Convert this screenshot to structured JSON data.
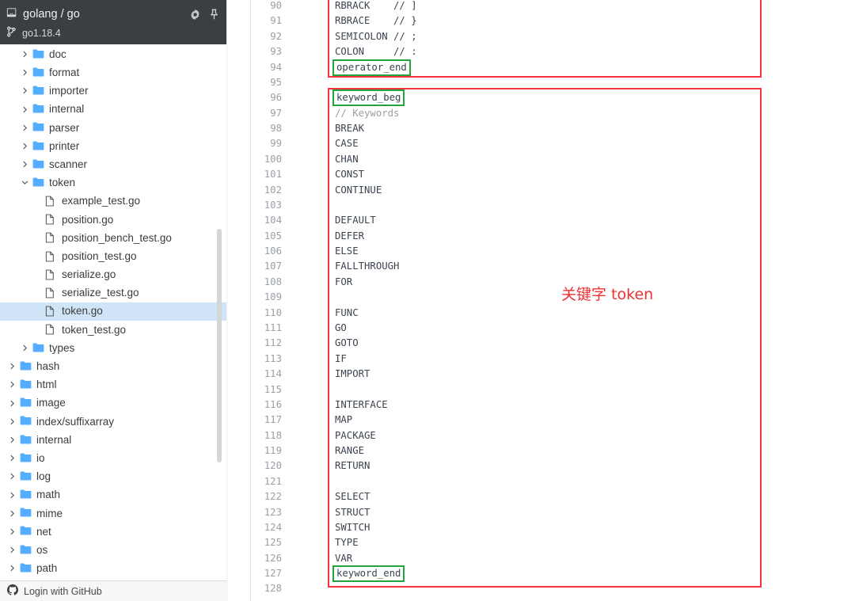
{
  "sidebar": {
    "header": {
      "repo_icon": "repository-icon",
      "repo_name": "golang / go",
      "branch_icon": "branch-icon",
      "branch_name": "go1.18.4",
      "settings_icon": "gear-icon",
      "pin_icon": "pin-icon"
    },
    "tree": [
      {
        "name": "doc",
        "type": "folder",
        "depth": 1,
        "expanded": false,
        "selected": false
      },
      {
        "name": "format",
        "type": "folder",
        "depth": 1,
        "expanded": false,
        "selected": false
      },
      {
        "name": "importer",
        "type": "folder",
        "depth": 1,
        "expanded": false,
        "selected": false
      },
      {
        "name": "internal",
        "type": "folder",
        "depth": 1,
        "expanded": false,
        "selected": false
      },
      {
        "name": "parser",
        "type": "folder",
        "depth": 1,
        "expanded": false,
        "selected": false
      },
      {
        "name": "printer",
        "type": "folder",
        "depth": 1,
        "expanded": false,
        "selected": false
      },
      {
        "name": "scanner",
        "type": "folder",
        "depth": 1,
        "expanded": false,
        "selected": false
      },
      {
        "name": "token",
        "type": "folder",
        "depth": 1,
        "expanded": true,
        "selected": false
      },
      {
        "name": "example_test.go",
        "type": "file",
        "depth": 2,
        "expanded": null,
        "selected": false
      },
      {
        "name": "position.go",
        "type": "file",
        "depth": 2,
        "expanded": null,
        "selected": false
      },
      {
        "name": "position_bench_test.go",
        "type": "file",
        "depth": 2,
        "expanded": null,
        "selected": false
      },
      {
        "name": "position_test.go",
        "type": "file",
        "depth": 2,
        "expanded": null,
        "selected": false
      },
      {
        "name": "serialize.go",
        "type": "file",
        "depth": 2,
        "expanded": null,
        "selected": false
      },
      {
        "name": "serialize_test.go",
        "type": "file",
        "depth": 2,
        "expanded": null,
        "selected": false
      },
      {
        "name": "token.go",
        "type": "file",
        "depth": 2,
        "expanded": null,
        "selected": true
      },
      {
        "name": "token_test.go",
        "type": "file",
        "depth": 2,
        "expanded": null,
        "selected": false
      },
      {
        "name": "types",
        "type": "folder",
        "depth": 1,
        "expanded": false,
        "selected": false
      },
      {
        "name": "hash",
        "type": "folder",
        "depth": 0,
        "expanded": false,
        "selected": false
      },
      {
        "name": "html",
        "type": "folder",
        "depth": 0,
        "expanded": false,
        "selected": false
      },
      {
        "name": "image",
        "type": "folder",
        "depth": 0,
        "expanded": false,
        "selected": false
      },
      {
        "name": "index/suffixarray",
        "type": "folder",
        "depth": 0,
        "expanded": false,
        "selected": false
      },
      {
        "name": "internal",
        "type": "folder",
        "depth": 0,
        "expanded": false,
        "selected": false
      },
      {
        "name": "io",
        "type": "folder",
        "depth": 0,
        "expanded": false,
        "selected": false
      },
      {
        "name": "log",
        "type": "folder",
        "depth": 0,
        "expanded": false,
        "selected": false
      },
      {
        "name": "math",
        "type": "folder",
        "depth": 0,
        "expanded": false,
        "selected": false
      },
      {
        "name": "mime",
        "type": "folder",
        "depth": 0,
        "expanded": false,
        "selected": false
      },
      {
        "name": "net",
        "type": "folder",
        "depth": 0,
        "expanded": false,
        "selected": false
      },
      {
        "name": "os",
        "type": "folder",
        "depth": 0,
        "expanded": false,
        "selected": false
      },
      {
        "name": "path",
        "type": "folder",
        "depth": 0,
        "expanded": false,
        "selected": false
      }
    ],
    "footer": {
      "icon": "github-icon",
      "label": "Login with GitHub"
    }
  },
  "code": {
    "first_line_number": 90,
    "lines": [
      {
        "n": 90,
        "text": "RBRACK    // ]",
        "style": "plain"
      },
      {
        "n": 91,
        "text": "RBRACE    // }",
        "style": "plain"
      },
      {
        "n": 92,
        "text": "SEMICOLON // ;",
        "style": "plain"
      },
      {
        "n": 93,
        "text": "COLON     // :",
        "style": "plain"
      },
      {
        "n": 94,
        "text": "operator_end",
        "style": "boxed"
      },
      {
        "n": 95,
        "text": "",
        "style": "plain"
      },
      {
        "n": 96,
        "text": "keyword_beg",
        "style": "boxed"
      },
      {
        "n": 97,
        "text": "// Keywords",
        "style": "comment"
      },
      {
        "n": 98,
        "text": "BREAK",
        "style": "plain"
      },
      {
        "n": 99,
        "text": "CASE",
        "style": "plain"
      },
      {
        "n": 100,
        "text": "CHAN",
        "style": "plain"
      },
      {
        "n": 101,
        "text": "CONST",
        "style": "plain"
      },
      {
        "n": 102,
        "text": "CONTINUE",
        "style": "plain"
      },
      {
        "n": 103,
        "text": "",
        "style": "plain"
      },
      {
        "n": 104,
        "text": "DEFAULT",
        "style": "plain"
      },
      {
        "n": 105,
        "text": "DEFER",
        "style": "plain"
      },
      {
        "n": 106,
        "text": "ELSE",
        "style": "plain"
      },
      {
        "n": 107,
        "text": "FALLTHROUGH",
        "style": "plain"
      },
      {
        "n": 108,
        "text": "FOR",
        "style": "plain"
      },
      {
        "n": 109,
        "text": "",
        "style": "plain"
      },
      {
        "n": 110,
        "text": "FUNC",
        "style": "plain"
      },
      {
        "n": 111,
        "text": "GO",
        "style": "plain"
      },
      {
        "n": 112,
        "text": "GOTO",
        "style": "plain"
      },
      {
        "n": 113,
        "text": "IF",
        "style": "plain"
      },
      {
        "n": 114,
        "text": "IMPORT",
        "style": "plain"
      },
      {
        "n": 115,
        "text": "",
        "style": "plain"
      },
      {
        "n": 116,
        "text": "INTERFACE",
        "style": "plain"
      },
      {
        "n": 117,
        "text": "MAP",
        "style": "plain"
      },
      {
        "n": 118,
        "text": "PACKAGE",
        "style": "plain"
      },
      {
        "n": 119,
        "text": "RANGE",
        "style": "plain"
      },
      {
        "n": 120,
        "text": "RETURN",
        "style": "plain"
      },
      {
        "n": 121,
        "text": "",
        "style": "plain"
      },
      {
        "n": 122,
        "text": "SELECT",
        "style": "plain"
      },
      {
        "n": 123,
        "text": "STRUCT",
        "style": "plain"
      },
      {
        "n": 124,
        "text": "SWITCH",
        "style": "plain"
      },
      {
        "n": 125,
        "text": "TYPE",
        "style": "plain"
      },
      {
        "n": 126,
        "text": "VAR",
        "style": "plain"
      },
      {
        "n": 127,
        "text": "keyword_end",
        "style": "boxed"
      },
      {
        "n": 128,
        "text": "",
        "style": "plain"
      }
    ]
  },
  "annotations": {
    "keyword_label": "关键字 token",
    "highlight_color": "#f5333f",
    "token_box_color": "#21a53f",
    "annotation_color": "#f03030"
  }
}
